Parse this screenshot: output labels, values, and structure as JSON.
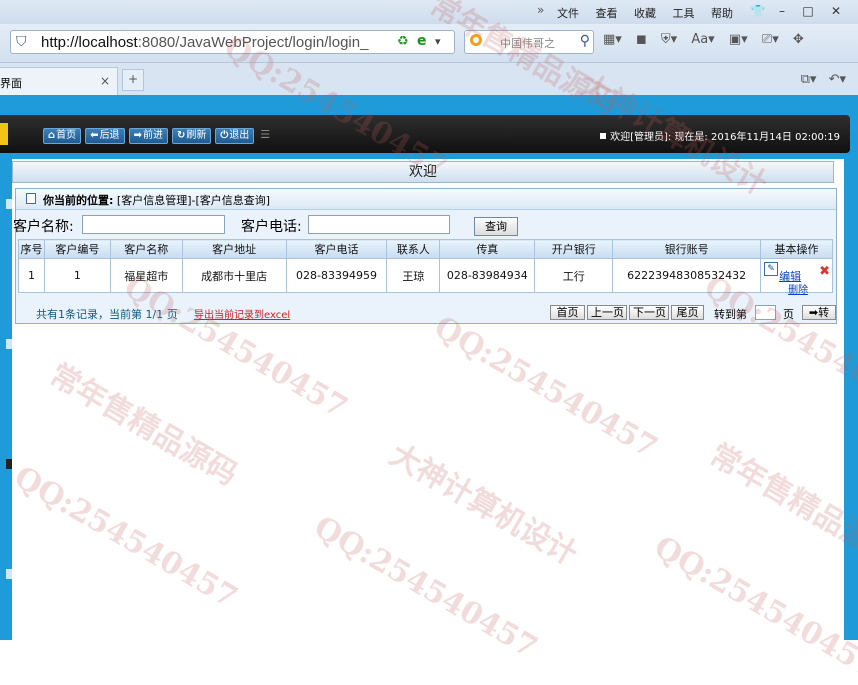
{
  "browser": {
    "menu": [
      "文件",
      "查看",
      "收藏",
      "工具",
      "帮助"
    ],
    "url_host": "http://localhost",
    "url_rest": ":8080/JavaWebProject/login/login_",
    "search_placeholder": "中国伟哥之",
    "tab_title": "界面",
    "close_glyph": "×",
    "newtab_glyph": "+"
  },
  "nav": {
    "home": "首页",
    "back": "后退",
    "forward": "前进",
    "refresh": "刷新",
    "logout": "退出",
    "welcome": "欢迎[管理员]: ",
    "now_label": "现在是: ",
    "datetime": "2016年11月14日 02:00:19"
  },
  "main": {
    "title": "欢迎",
    "location_label": "你当前的位置:",
    "location_path": "[客户信息管理]-[客户信息查询]"
  },
  "filters": {
    "name_label": "客户名称:",
    "phone_label": "客户电话:",
    "name_value": "",
    "phone_value": "",
    "query_button": "查询"
  },
  "table": {
    "headers": [
      "序号",
      "客户编号",
      "客户名称",
      "客户地址",
      "客户电话",
      "联系人",
      "传真",
      "开户银行",
      "银行账号",
      "基本操作"
    ],
    "rows": [
      {
        "no": "1",
        "code": "1",
        "name": "福星超市",
        "address": "成都市十里店",
        "phone": "028-83394959",
        "contact": "王琼",
        "fax": "028-83984934",
        "bank": "工行",
        "account": "62223948308532432",
        "edit": "编辑",
        "delete": "删除"
      }
    ]
  },
  "pager": {
    "summary": "共有1条记录，当前第 1/1 页",
    "export": "导出当前记录到excel",
    "first": "首页",
    "prev": "上一页",
    "next": "下一页",
    "last": "尾页",
    "goto": "转到第",
    "page_unit": "页",
    "go": "➡转",
    "page_value": ""
  },
  "watermarks": {
    "qq": "QQ:254540457",
    "shop": "常年售精品源码",
    "design": "大神计算机设计"
  },
  "colors": {
    "frame_blue": "#1e9bd8",
    "nav_black": "#1a1a1a",
    "link_red": "#d02020"
  }
}
